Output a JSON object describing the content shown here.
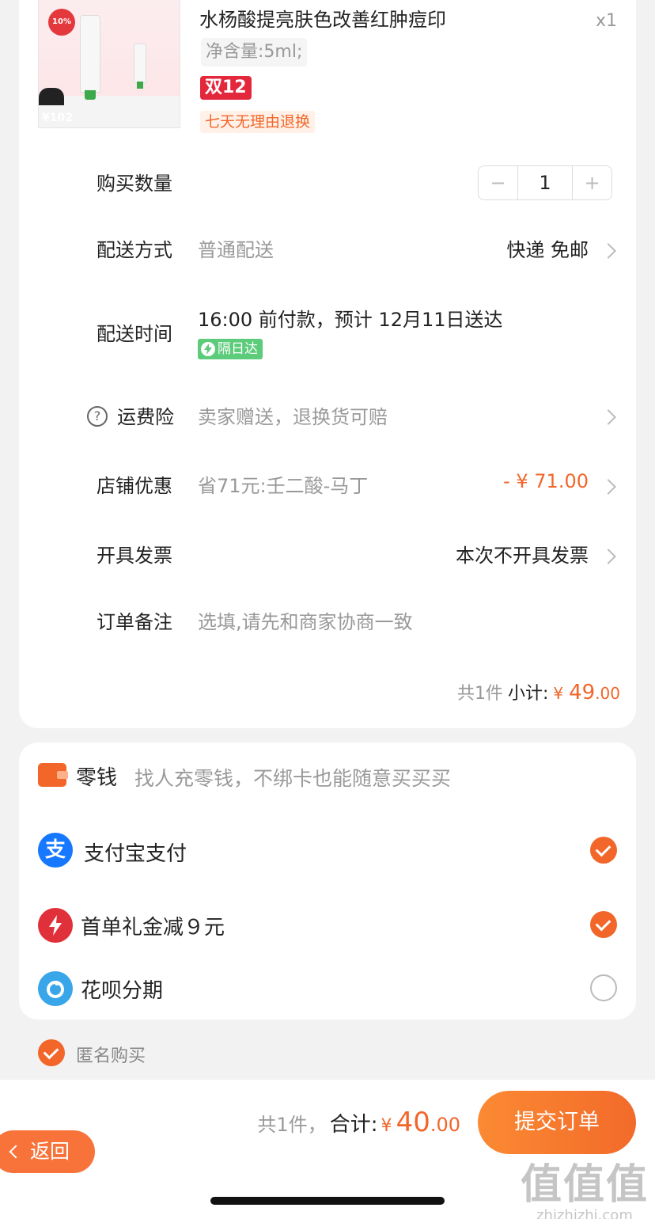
{
  "product": {
    "title": "水杨酸提亮肤色改善红肿痘印",
    "quantity_badge": "x1",
    "spec": "净含量:5ml;",
    "promo_tag": "双12",
    "return_tag": "七天无理由退换",
    "thumb_badge": "10%",
    "thumb_price": "¥102"
  },
  "quantity_row": {
    "label": "购买数量",
    "minus": "−",
    "value": "1",
    "plus": "+"
  },
  "delivery_method": {
    "label": "配送方式",
    "value": "普通配送",
    "right": "快递 免邮"
  },
  "delivery_time": {
    "label": "配送时间",
    "value": "16:00 前付款，预计 12月11日送达",
    "tag": "隔日达"
  },
  "freight_insurance": {
    "help": "?",
    "label": "运费险",
    "value": "卖家赠送，退换货可赔"
  },
  "store_discount": {
    "label": "店铺优惠",
    "value": "省71元:壬二酸-马丁",
    "amount": "- ¥ 71.00"
  },
  "invoice": {
    "label": "开具发票",
    "value": "本次不开具发票"
  },
  "remark": {
    "label": "订单备注",
    "placeholder": "选填,请先和商家协商一致"
  },
  "subtotal": {
    "count": "共1件",
    "label": "小计:",
    "currency": "¥",
    "integer": "49",
    "decimal": ".00"
  },
  "payment": {
    "change_label": "零钱",
    "change_hint": "找人充零钱，不绑卡也能随意买买买",
    "alipay_icon": "支",
    "alipay_label": "支付宝支付",
    "first_order_label": "首单礼金减９元",
    "huabei_label": "花呗分期"
  },
  "anonymous": {
    "label": "匿名购买"
  },
  "footer": {
    "count": "共1件，",
    "total_label": "合计:",
    "currency": "¥",
    "integer": "40",
    "decimal": ".00",
    "submit": "提交订单",
    "back": "返回"
  },
  "watermark": {
    "big": "值值值",
    "small": "zhizhizhi.com"
  },
  "colors": {
    "accent": "#f2662a",
    "promo_red": "#e4283c",
    "next_day_green": "#5ccb7a",
    "alipay_blue": "#1677ff"
  }
}
